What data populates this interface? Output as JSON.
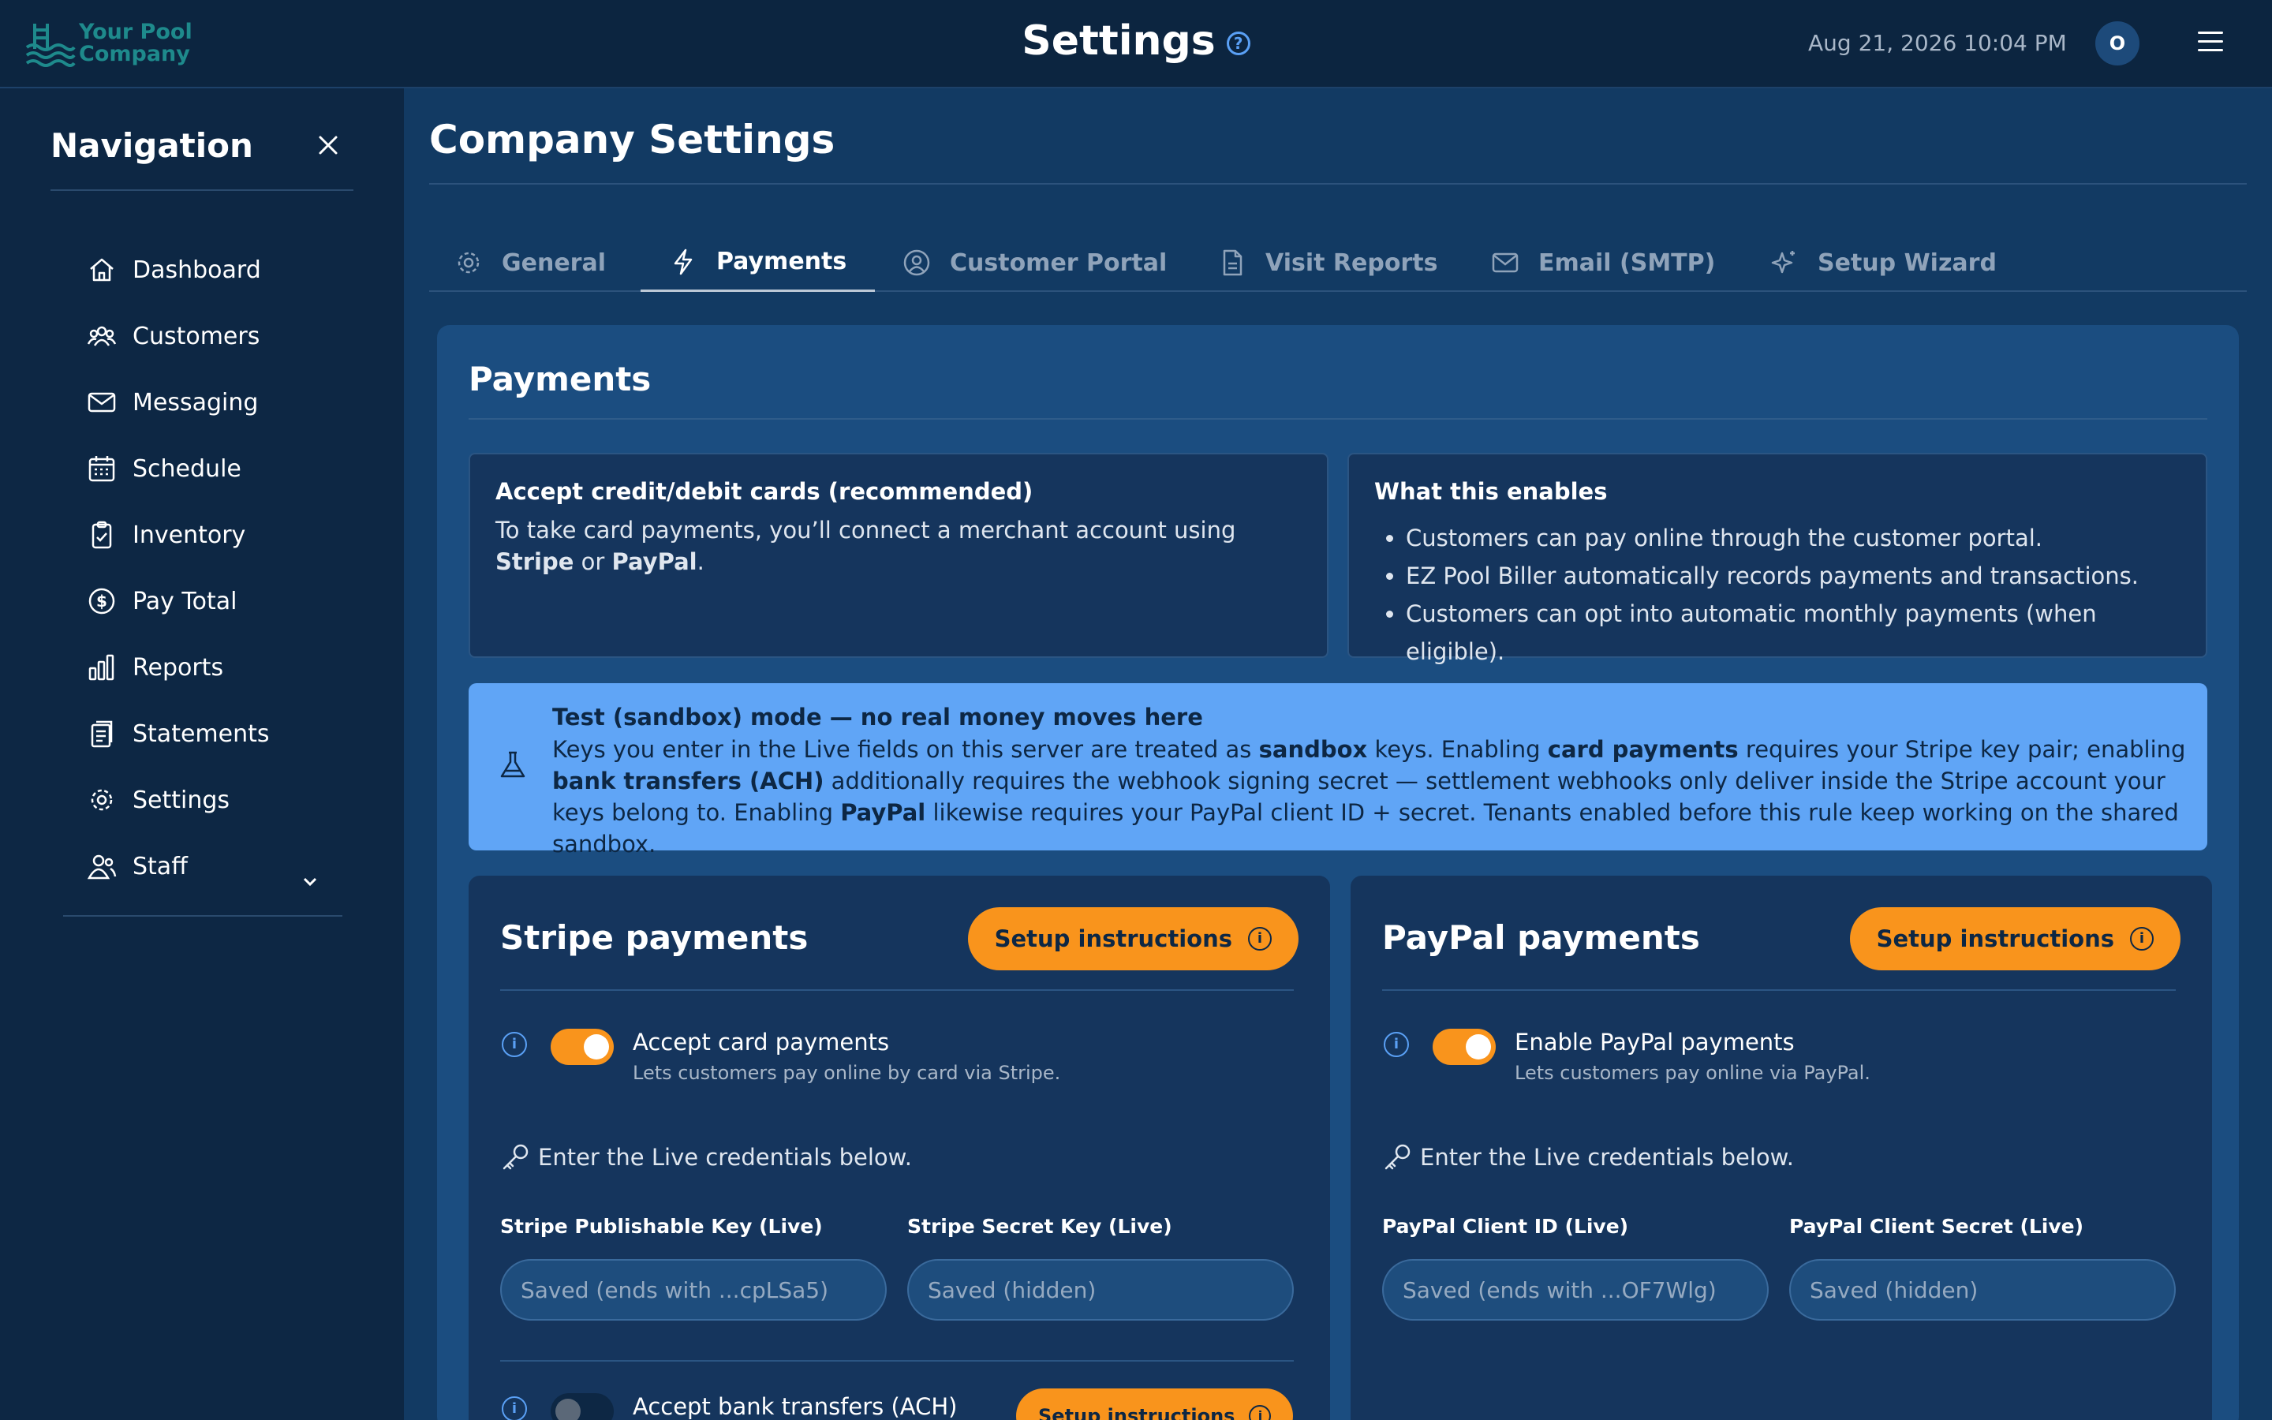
{
  "header": {
    "logo_text_line1": "Your Pool",
    "logo_text_line2": "Company",
    "title": "Settings",
    "help_icon": "?",
    "datetime": "Aug 21, 2026 10:04 PM",
    "avatar_initial": "O"
  },
  "sidebar": {
    "title": "Navigation",
    "items": [
      {
        "label": "Dashboard",
        "icon": "home-icon"
      },
      {
        "label": "Customers",
        "icon": "users-icon"
      },
      {
        "label": "Messaging",
        "icon": "mail-icon"
      },
      {
        "label": "Schedule",
        "icon": "calendar-icon"
      },
      {
        "label": "Inventory",
        "icon": "clipboard-check-icon"
      },
      {
        "label": "Pay Total",
        "icon": "dollar-circle-icon"
      },
      {
        "label": "Reports",
        "icon": "bar-chart-icon"
      },
      {
        "label": "Statements",
        "icon": "document-stack-icon"
      },
      {
        "label": "Settings",
        "icon": "gear-icon"
      },
      {
        "label": "Staff",
        "icon": "staff-icon"
      }
    ]
  },
  "main": {
    "title": "Company Settings",
    "tabs": [
      {
        "label": "General",
        "icon": "gear-icon",
        "active": false
      },
      {
        "label": "Payments",
        "icon": "lightning-icon",
        "active": true
      },
      {
        "label": "Customer Portal",
        "icon": "user-circle-icon",
        "active": false
      },
      {
        "label": "Visit Reports",
        "icon": "file-icon",
        "active": false
      },
      {
        "label": "Email (SMTP)",
        "icon": "envelope-icon",
        "active": false
      },
      {
        "label": "Setup Wizard",
        "icon": "sparkle-icon",
        "active": false
      }
    ]
  },
  "payments": {
    "title": "Payments",
    "accept_box": {
      "title": "Accept credit/debit cards (recommended)",
      "text_before": "To take card payments, you’ll connect a merchant account using ",
      "stripe": "Stripe",
      "or": " or ",
      "paypal": "PayPal",
      "end": "."
    },
    "enables_box": {
      "title": "What this enables",
      "items": [
        "Customers can pay online through the customer portal.",
        "EZ Pool Biller automatically records payments and transactions.",
        "Customers can opt into automatic monthly payments (when eligible)."
      ]
    },
    "sandbox": {
      "title": "Test (sandbox) mode — no real money moves here",
      "t1": "Keys you enter in the Live fields on this server are treated as ",
      "b1": "sandbox",
      "t2": " keys. Enabling ",
      "b2": "card payments",
      "t3": " requires your Stripe key pair; enabling ",
      "b3": "bank transfers (ACH)",
      "t4": " additionally requires the webhook signing secret — settlement webhooks only deliver inside the Stripe account your keys belong to. Enabling ",
      "b4": "PayPal",
      "t5": " likewise requires your PayPal client ID + secret. Tenants enabled before this rule keep working on the shared sandbox."
    },
    "stripe": {
      "title": "Stripe payments",
      "setup_label": "Setup instructions",
      "toggle_label": "Accept card payments",
      "toggle_sub": "Lets customers pay online by card via Stripe.",
      "toggle_on": true,
      "credentials_note": "Enter the Live credentials below.",
      "field1_label": "Stripe Publishable Key (Live)",
      "field1_placeholder": "Saved (ends with ...cpLSa5)",
      "field2_label": "Stripe Secret Key (Live)",
      "field2_placeholder": "Saved (hidden)",
      "ach_label": "Accept bank transfers (ACH)",
      "ach_on": false,
      "ach_setup_label": "Setup instructions"
    },
    "paypal": {
      "title": "PayPal payments",
      "setup_label": "Setup instructions",
      "toggle_label": "Enable PayPal payments",
      "toggle_sub": "Lets customers pay online via PayPal.",
      "toggle_on": true,
      "credentials_note": "Enter the Live credentials below.",
      "field1_label": "PayPal Client ID (Live)",
      "field1_placeholder": "Saved (ends with ...OF7Wlg)",
      "field2_label": "PayPal Client Secret (Live)",
      "field2_placeholder": "Saved (hidden)"
    }
  },
  "colors": {
    "accent_orange": "#f9941c",
    "sandbox_blue": "#60a5f6",
    "background": "#123a63",
    "sidebar": "#0d2744"
  }
}
